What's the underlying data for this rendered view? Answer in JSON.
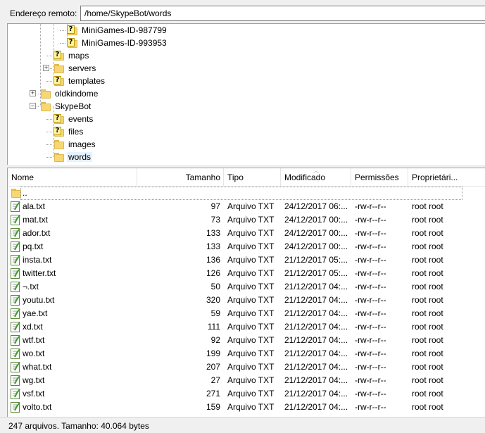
{
  "address": {
    "label": "Endereço remoto:",
    "value": "/home/SkypeBot/words"
  },
  "tree": {
    "items": [
      {
        "label": "MiniGames-ID-987799",
        "icon": "folder-unknown-icon"
      },
      {
        "label": "MiniGames-ID-993953",
        "icon": "folder-unknown-icon"
      },
      {
        "label": "maps",
        "icon": "folder-unknown-icon"
      },
      {
        "label": "servers",
        "icon": "folder-icon",
        "expander": "+"
      },
      {
        "label": "templates",
        "icon": "folder-unknown-icon"
      },
      {
        "label": "oldkindome",
        "icon": "folder-icon",
        "expander": "+"
      },
      {
        "label": "SkypeBot",
        "icon": "folder-icon",
        "expander": "-"
      },
      {
        "label": "events",
        "icon": "folder-unknown-icon"
      },
      {
        "label": "files",
        "icon": "folder-unknown-icon"
      },
      {
        "label": "images",
        "icon": "folder-icon"
      },
      {
        "label": "words",
        "icon": "folder-icon",
        "selected": true
      }
    ]
  },
  "list": {
    "columns": {
      "name": "Nome",
      "size": "Tamanho",
      "type": "Tipo",
      "modified": "Modificado",
      "permissions": "Permissões",
      "owner": "Proprietári..."
    },
    "parent_label": "..",
    "files": [
      {
        "name": "ala.txt",
        "size": "97",
        "type": "Arquivo TXT",
        "modified": "24/12/2017 06:...",
        "perm": "-rw-r--r--",
        "owner": "root root"
      },
      {
        "name": "mat.txt",
        "size": "73",
        "type": "Arquivo TXT",
        "modified": "24/12/2017 00:...",
        "perm": "-rw-r--r--",
        "owner": "root root"
      },
      {
        "name": "ador.txt",
        "size": "133",
        "type": "Arquivo TXT",
        "modified": "24/12/2017 00:...",
        "perm": "-rw-r--r--",
        "owner": "root root"
      },
      {
        "name": "pq.txt",
        "size": "133",
        "type": "Arquivo TXT",
        "modified": "24/12/2017 00:...",
        "perm": "-rw-r--r--",
        "owner": "root root"
      },
      {
        "name": "insta.txt",
        "size": "136",
        "type": "Arquivo TXT",
        "modified": "21/12/2017 05:...",
        "perm": "-rw-r--r--",
        "owner": "root root"
      },
      {
        "name": "twitter.txt",
        "size": "126",
        "type": "Arquivo TXT",
        "modified": "21/12/2017 05:...",
        "perm": "-rw-r--r--",
        "owner": "root root"
      },
      {
        "name": "¬.txt",
        "size": "50",
        "type": "Arquivo TXT",
        "modified": "21/12/2017 04:...",
        "perm": "-rw-r--r--",
        "owner": "root root"
      },
      {
        "name": "youtu.txt",
        "size": "320",
        "type": "Arquivo TXT",
        "modified": "21/12/2017 04:...",
        "perm": "-rw-r--r--",
        "owner": "root root"
      },
      {
        "name": "yae.txt",
        "size": "59",
        "type": "Arquivo TXT",
        "modified": "21/12/2017 04:...",
        "perm": "-rw-r--r--",
        "owner": "root root"
      },
      {
        "name": "xd.txt",
        "size": "111",
        "type": "Arquivo TXT",
        "modified": "21/12/2017 04:...",
        "perm": "-rw-r--r--",
        "owner": "root root"
      },
      {
        "name": "wtf.txt",
        "size": "92",
        "type": "Arquivo TXT",
        "modified": "21/12/2017 04:...",
        "perm": "-rw-r--r--",
        "owner": "root root"
      },
      {
        "name": "wo.txt",
        "size": "199",
        "type": "Arquivo TXT",
        "modified": "21/12/2017 04:...",
        "perm": "-rw-r--r--",
        "owner": "root root"
      },
      {
        "name": "what.txt",
        "size": "207",
        "type": "Arquivo TXT",
        "modified": "21/12/2017 04:...",
        "perm": "-rw-r--r--",
        "owner": "root root"
      },
      {
        "name": "wg.txt",
        "size": "27",
        "type": "Arquivo TXT",
        "modified": "21/12/2017 04:...",
        "perm": "-rw-r--r--",
        "owner": "root root"
      },
      {
        "name": "vsf.txt",
        "size": "271",
        "type": "Arquivo TXT",
        "modified": "21/12/2017 04:...",
        "perm": "-rw-r--r--",
        "owner": "root root"
      },
      {
        "name": "volto.txt",
        "size": "159",
        "type": "Arquivo TXT",
        "modified": "21/12/2017 04:...",
        "perm": "-rw-r--r--",
        "owner": "root root"
      }
    ]
  },
  "status": {
    "text": "247 arquivos. Tamanho: 40.064 bytes"
  },
  "colors": {
    "folder": "#f7d774",
    "selection": "#e5f3ff",
    "border": "#a0a0a0"
  }
}
